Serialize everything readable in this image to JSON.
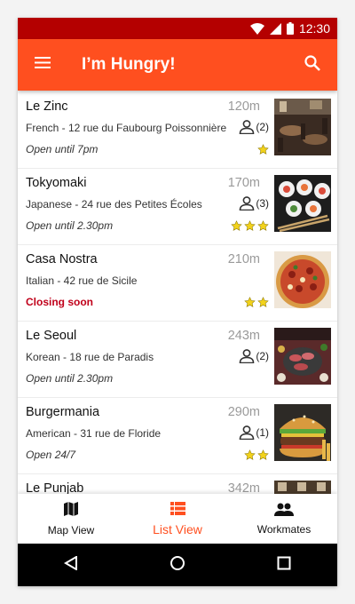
{
  "status_bar": {
    "time": "12:30"
  },
  "app_bar": {
    "title": "I’m Hungry!"
  },
  "restaurants": [
    {
      "name": "Le Zinc",
      "distance": "120m",
      "address": "French - 12 rue du Faubourg Poissonnière",
      "hours": "Open until 7pm",
      "closing": false,
      "workmates": "(2)",
      "stars": 1
    },
    {
      "name": "Tokyomaki",
      "distance": "170m",
      "address": "Japanese - 24 rue des Petites Écoles",
      "hours": "Open until 2.30pm",
      "closing": false,
      "workmates": "(3)",
      "stars": 3
    },
    {
      "name": "Casa Nostra",
      "distance": "210m",
      "address": "Italian - 42 rue de Sicile",
      "hours": "Closing soon",
      "closing": true,
      "workmates": "",
      "stars": 2
    },
    {
      "name": "Le Seoul",
      "distance": "243m",
      "address": "Korean - 18 rue de Paradis",
      "hours": "Open until 2.30pm",
      "closing": false,
      "workmates": "(2)",
      "stars": 0
    },
    {
      "name": "Burgermania",
      "distance": "290m",
      "address": "American - 31 rue de Floride",
      "hours": "Open 24/7",
      "closing": false,
      "workmates": "(1)",
      "stars": 2
    },
    {
      "name": "Le Punjab",
      "distance": "342m",
      "address": "",
      "hours": "",
      "closing": false,
      "workmates": "",
      "stars": 0
    }
  ],
  "bottom_nav": {
    "tabs": [
      {
        "label": "Map View",
        "icon": "map-icon",
        "active": false
      },
      {
        "label": "List View",
        "icon": "list-icon",
        "active": true
      },
      {
        "label": "Workmates",
        "icon": "people-icon",
        "active": false
      }
    ]
  },
  "colors": {
    "accent": "#ff4f1f",
    "status_bar": "#b40000",
    "star": "#f2d21b",
    "closing": "#c0001a"
  }
}
